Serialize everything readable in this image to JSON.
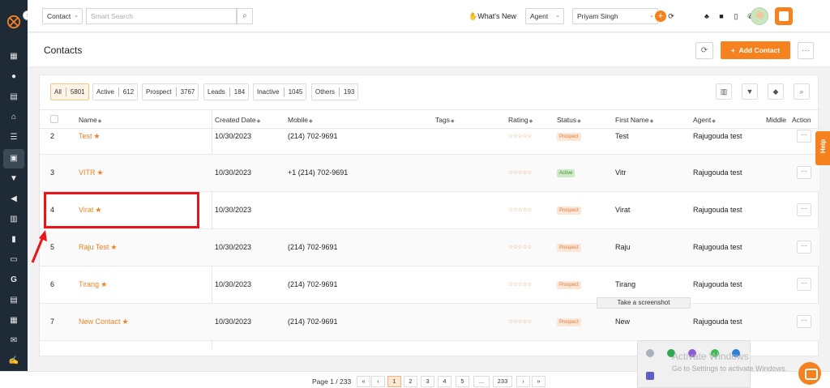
{
  "topbar": {
    "module_select": "Contact",
    "search_placeholder": "Smart Search",
    "whats_new": "What's New",
    "role_select": "Agent",
    "user_select": "Priyam Singh"
  },
  "page": {
    "title": "Contacts",
    "add_button": "Add Contact"
  },
  "filters": [
    {
      "label": "All",
      "count": "5801"
    },
    {
      "label": "Active",
      "count": "612"
    },
    {
      "label": "Prospect",
      "count": "3767"
    },
    {
      "label": "Leads",
      "count": "184"
    },
    {
      "label": "Inactive",
      "count": "1045"
    },
    {
      "label": "Others",
      "count": "193"
    }
  ],
  "columns": [
    "Name",
    "Created Date",
    "Mobile",
    "Tags",
    "Rating",
    "Status",
    "First Name",
    "Agent",
    "Middle",
    "Action"
  ],
  "rows": [
    {
      "num": "2",
      "name": "Test",
      "date": "10/30/2023",
      "mobile": "(214) 702-9691",
      "status": "Prospect",
      "first": "Test",
      "agent": "Rajugouda test"
    },
    {
      "num": "3",
      "name": "VITR",
      "date": "10/30/2023",
      "mobile": "+1 (214) 702-9691",
      "status": "Active",
      "first": "Vitr",
      "agent": "Rajugouda test"
    },
    {
      "num": "4",
      "name": "Virat",
      "date": "10/30/2023",
      "mobile": "",
      "status": "Prospect",
      "first": "Virat",
      "agent": "Rajugouda test"
    },
    {
      "num": "5",
      "name": "Raju Test",
      "date": "10/30/2023",
      "mobile": "(214) 702-9691",
      "status": "Prospect",
      "first": "Raju",
      "agent": "Rajugouda test"
    },
    {
      "num": "6",
      "name": "Tirang",
      "date": "10/30/2023",
      "mobile": "(214) 702-9691",
      "status": "Prospect",
      "first": "Tirang",
      "agent": "Rajugouda test"
    },
    {
      "num": "7",
      "name": "New Contact",
      "date": "10/30/2023",
      "mobile": "(214) 702-9691",
      "status": "Prospect",
      "first": "New",
      "agent": "Rajugouda test"
    }
  ],
  "tooltip": "Take a screenshot",
  "help_tab": "Help",
  "pagination": {
    "info": "Page 1 / 233",
    "pages": [
      "1",
      "2",
      "3",
      "4",
      "5",
      "...",
      "233"
    ]
  },
  "watermark": {
    "line1": "Activate Windows",
    "line2": "Go to Settings to activate Windows."
  },
  "colors": {
    "accent": "#f5821f",
    "sidebar": "#1e2a36",
    "annotation": "#e8161b"
  }
}
